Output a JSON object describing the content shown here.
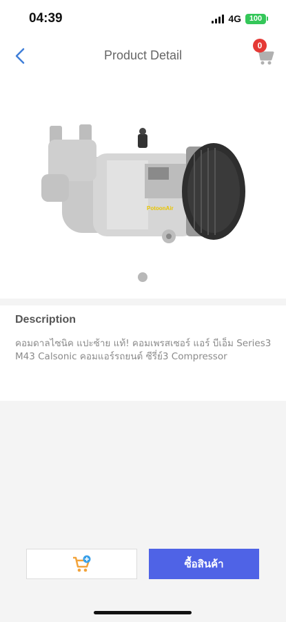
{
  "status_bar": {
    "time": "04:39",
    "network": "4G",
    "battery": "100"
  },
  "header": {
    "title": "Product Detail",
    "cart_count": "0",
    "back_icon": "chevron-left-icon",
    "cart_icon": "cart-icon"
  },
  "product": {
    "image_watermark": "PotoonAir",
    "carousel_count": 1,
    "carousel_active": 1
  },
  "description": {
    "heading": "Description",
    "text": "คอมดาลไซนิค แปะซ้าย แท้! คอมเพรสเซอร์ แอร์ บีเอ็ม Series3 M43 Calsonic คอมแอร์รถยนต์ ซีรี่ย์3 Compressor"
  },
  "actions": {
    "add_to_cart_icon": "add-to-cart-icon",
    "buy_label": "ซื้อสินค้า"
  },
  "colors": {
    "accent": "#4f63e6",
    "badge": "#e53935",
    "battery": "#34c759",
    "back_icon": "#3f7ed8"
  }
}
